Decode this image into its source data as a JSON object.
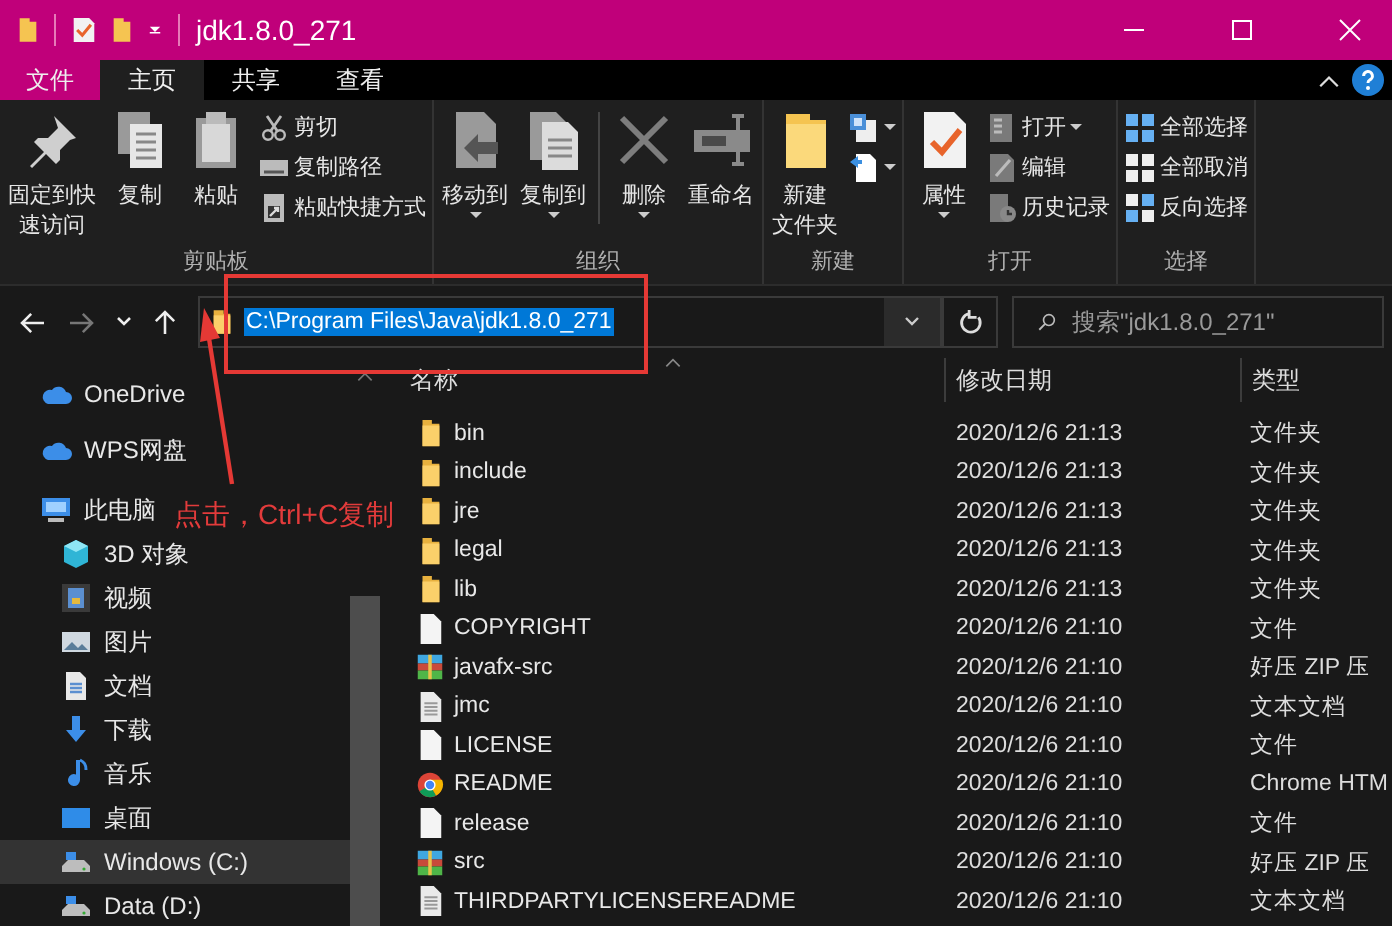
{
  "window": {
    "title": "jdk1.8.0_271"
  },
  "ribbon_tabs": [
    {
      "label": "文件",
      "selected": false,
      "kind": "file_menu"
    },
    {
      "label": "主页",
      "selected": true,
      "kind": "tab"
    },
    {
      "label": "共享",
      "selected": false,
      "kind": "tab"
    },
    {
      "label": "查看",
      "selected": false,
      "kind": "tab"
    }
  ],
  "ribbon_groups": [
    {
      "label": "剪贴板",
      "items": [
        {
          "kind": "large",
          "label_lines": [
            "固定到快",
            "速访问"
          ],
          "dropdown": false
        },
        {
          "kind": "large",
          "label": "复制",
          "dropdown": false
        },
        {
          "kind": "large",
          "label": "粘贴",
          "dropdown": false
        },
        {
          "kind": "small",
          "label": "剪切",
          "dropdown": false
        },
        {
          "kind": "small",
          "label": "复制路径",
          "dropdown": false
        },
        {
          "kind": "small",
          "label": "粘贴快捷方式",
          "dropdown": false
        }
      ]
    },
    {
      "label": "组织",
      "items": [
        {
          "kind": "large",
          "label": "移动到",
          "dropdown": true
        },
        {
          "kind": "large",
          "label": "复制到",
          "dropdown": true
        },
        {
          "kind": "divider"
        },
        {
          "kind": "large",
          "label": "删除",
          "dropdown": true
        },
        {
          "kind": "large",
          "label": "重命名",
          "dropdown": false
        }
      ]
    },
    {
      "label": "新建",
      "items": [
        {
          "kind": "large",
          "label_lines": [
            "新建",
            "文件夹"
          ],
          "dropdown": false
        },
        {
          "kind": "small",
          "dropdown": true
        },
        {
          "kind": "small",
          "dropdown": true
        }
      ]
    },
    {
      "label": "打开",
      "items": [
        {
          "kind": "large",
          "label": "属性",
          "dropdown": true
        },
        {
          "kind": "small",
          "label": "打开",
          "dropdown": true
        },
        {
          "kind": "small",
          "label": "编辑",
          "dropdown": false
        },
        {
          "kind": "small",
          "label": "历史记录",
          "dropdown": false
        }
      ]
    },
    {
      "label": "选择",
      "items": [
        {
          "kind": "small",
          "label": "全部选择",
          "dropdown": false
        },
        {
          "kind": "small",
          "label": "全部取消",
          "dropdown": false
        },
        {
          "kind": "small",
          "label": "反向选择",
          "dropdown": false
        }
      ]
    }
  ],
  "address_bar": {
    "path": "C:\\Program Files\\Java\\jdk1.8.0_271",
    "selected": true
  },
  "search": {
    "placeholder": "搜索\"jdk1.8.0_271\""
  },
  "sidebar": {
    "items": [
      {
        "label": "OneDrive",
        "selected": false
      },
      {
        "label": "WPS网盘",
        "selected": false
      },
      {
        "label": "此电脑",
        "selected": false,
        "children": [
          {
            "label": "3D 对象",
            "selected": false
          },
          {
            "label": "视频",
            "selected": false
          },
          {
            "label": "图片",
            "selected": false
          },
          {
            "label": "文档",
            "selected": false
          },
          {
            "label": "下载",
            "selected": false
          },
          {
            "label": "音乐",
            "selected": false
          },
          {
            "label": "桌面",
            "selected": false
          },
          {
            "label": "Windows (C:)",
            "selected": true
          },
          {
            "label": "Data (D:)",
            "selected": false
          }
        ]
      }
    ]
  },
  "table": {
    "columns": [
      "名称",
      "修改日期",
      "类型"
    ],
    "rows": [
      {
        "name": "bin",
        "modified": "2020/12/6 21:13",
        "type": "文件夹",
        "kind": "folder"
      },
      {
        "name": "include",
        "modified": "2020/12/6 21:13",
        "type": "文件夹",
        "kind": "folder"
      },
      {
        "name": "jre",
        "modified": "2020/12/6 21:13",
        "type": "文件夹",
        "kind": "folder"
      },
      {
        "name": "legal",
        "modified": "2020/12/6 21:13",
        "type": "文件夹",
        "kind": "folder"
      },
      {
        "name": "lib",
        "modified": "2020/12/6 21:13",
        "type": "文件夹",
        "kind": "folder"
      },
      {
        "name": "COPYRIGHT",
        "modified": "2020/12/6 21:10",
        "type": "文件",
        "kind": "file"
      },
      {
        "name": "javafx-src",
        "modified": "2020/12/6 21:10",
        "type": "好压 ZIP 压",
        "kind": "zip"
      },
      {
        "name": "jmc",
        "modified": "2020/12/6 21:10",
        "type": "文本文档",
        "kind": "text"
      },
      {
        "name": "LICENSE",
        "modified": "2020/12/6 21:10",
        "type": "文件",
        "kind": "file"
      },
      {
        "name": "README",
        "modified": "2020/12/6 21:10",
        "type": "Chrome HTM",
        "kind": "chrome"
      },
      {
        "name": "release",
        "modified": "2020/12/6 21:10",
        "type": "文件",
        "kind": "file"
      },
      {
        "name": "src",
        "modified": "2020/12/6 21:10",
        "type": "好压 ZIP 压",
        "kind": "zip"
      },
      {
        "name": "THIRDPARTYLICENSEREADME",
        "modified": "2020/12/6 21:10",
        "type": "文本文档",
        "kind": "text"
      }
    ]
  },
  "annotation": {
    "text": "点击，Ctrl+C复制"
  }
}
